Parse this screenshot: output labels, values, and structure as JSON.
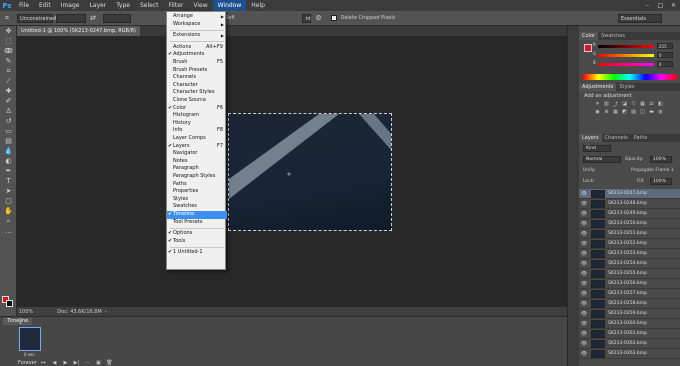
{
  "app": {
    "logo": "Ps"
  },
  "menubar": [
    "File",
    "Edit",
    "Image",
    "Layer",
    "Type",
    "Select",
    "Filter",
    "View",
    "Window",
    "Help"
  ],
  "window_controls": [
    "minimize-icon",
    "maximize-icon",
    "close-icon"
  ],
  "options": {
    "style": "Unconstrained",
    "refine_label": "Refi",
    "fill_partial": "nt",
    "delete_cropped": "Delete Cropped Pixels",
    "workspace": "Essentials"
  },
  "document_tab": "Untitled-1 @ 100% (SK213-0247.bmp, RGB/8) *",
  "statusbar": {
    "zoom": "100%",
    "doc": "Doc: 43.6K/16.8M"
  },
  "timeline": {
    "title": "Timeline",
    "frame_number": "1",
    "frame_delay": "0 sec.",
    "loop": "Forever"
  },
  "window_menu": [
    {
      "label": "Arrange",
      "submenu": true
    },
    {
      "label": "Workspace",
      "submenu": true
    },
    {
      "sep": true
    },
    {
      "label": "Extensions",
      "submenu": true
    },
    {
      "sep": true
    },
    {
      "label": "Actions",
      "shortcut": "Alt+F9"
    },
    {
      "label": "Adjustments",
      "checked": true
    },
    {
      "label": "Brush",
      "shortcut": "F5"
    },
    {
      "label": "Brush Presets"
    },
    {
      "label": "Channels"
    },
    {
      "label": "Character"
    },
    {
      "label": "Character Styles"
    },
    {
      "label": "Clone Source"
    },
    {
      "label": "Color",
      "shortcut": "F6",
      "checked": true
    },
    {
      "label": "Histogram"
    },
    {
      "label": "History"
    },
    {
      "label": "Info",
      "shortcut": "F8"
    },
    {
      "label": "Layer Comps"
    },
    {
      "label": "Layers",
      "shortcut": "F7",
      "checked": true
    },
    {
      "label": "Navigator"
    },
    {
      "label": "Notes"
    },
    {
      "label": "Paragraph"
    },
    {
      "label": "Paragraph Styles"
    },
    {
      "label": "Paths"
    },
    {
      "label": "Properties"
    },
    {
      "label": "Styles"
    },
    {
      "label": "Swatches"
    },
    {
      "label": "Timeline",
      "checked": true,
      "highlighted": true
    },
    {
      "label": "Tool Presets"
    },
    {
      "sep": true
    },
    {
      "label": "Options",
      "checked": true
    },
    {
      "label": "Tools",
      "checked": true
    },
    {
      "sep": true
    },
    {
      "label": "1 Untitled-1",
      "checked": true
    }
  ],
  "color_panel": {
    "tabs": [
      "Color",
      "Swatches"
    ],
    "values": [
      "255",
      "0",
      "0"
    ],
    "channels": [
      "R",
      "G",
      "B"
    ]
  },
  "adjustments_panel": {
    "tabs": [
      "Adjustments",
      "Styles"
    ],
    "title": "Add an adjustment"
  },
  "layers_panel": {
    "tabs": [
      "Layers",
      "Channels",
      "Paths"
    ],
    "filter": "Kind",
    "blend_mode": "Normal",
    "opacity_label": "Opacity:",
    "opacity": "100%",
    "unify_label": "Unify:",
    "propagate": "Propagate Frame 1",
    "lock_label": "Lock:",
    "fill_label": "Fill:",
    "fill": "100%",
    "layers": [
      "SK213-0247.bmp",
      "SK213-0248.bmp",
      "SK213-0249.bmp",
      "SK213-0250.bmp",
      "SK213-0251.bmp",
      "SK213-0252.bmp",
      "SK213-0253.bmp",
      "SK213-0254.bmp",
      "SK213-0255.bmp",
      "SK213-0256.bmp",
      "SK213-0257.bmp",
      "SK213-0258.bmp",
      "SK213-0259.bmp",
      "SK213-0260.bmp",
      "SK213-0261.bmp",
      "SK213-0262.bmp",
      "SK213-0263.bmp"
    ]
  },
  "colors": {
    "foreground": "#d91919",
    "background": "#111111",
    "menu_highlight": "#3f8ff1"
  }
}
